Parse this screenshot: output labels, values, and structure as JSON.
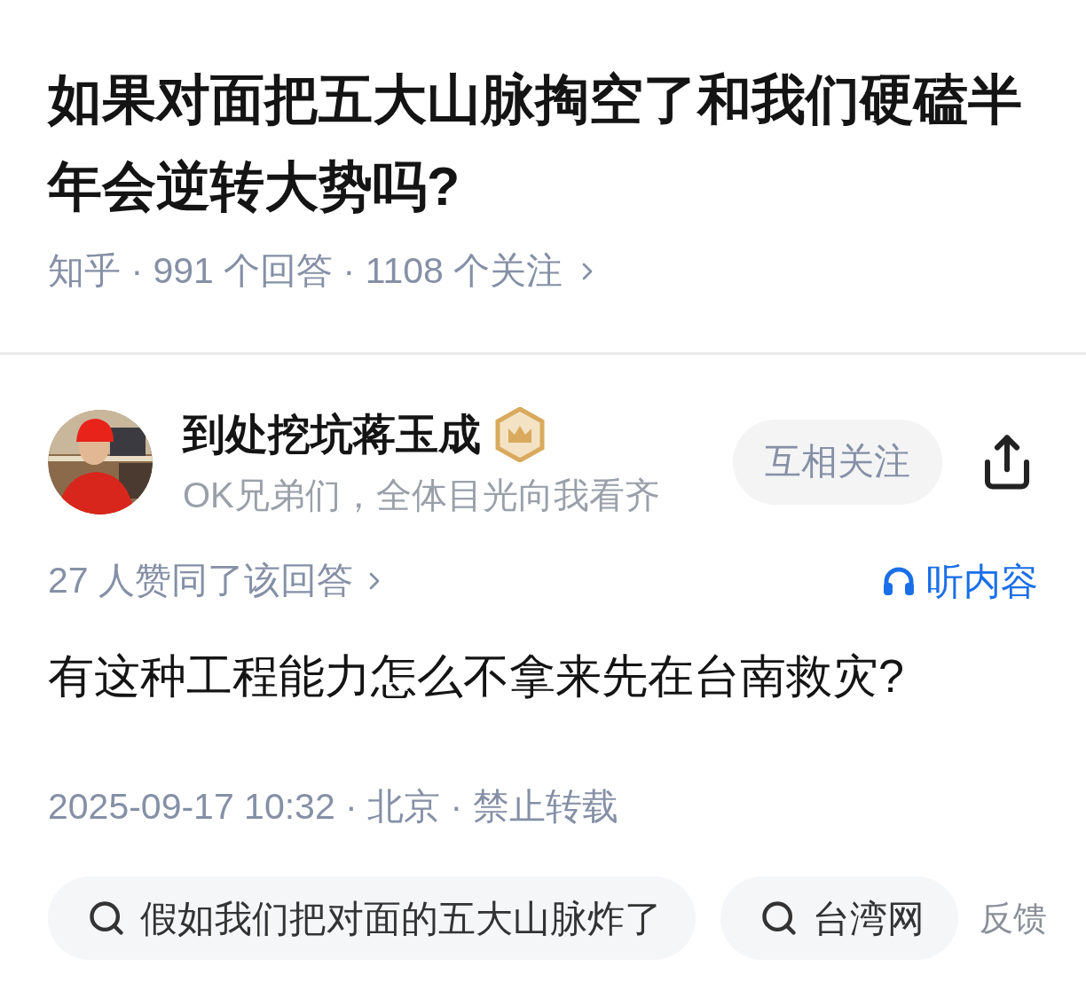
{
  "question": {
    "title": "如果对面把五大山脉掏空了和我们硬磕半年会逆转大势吗?",
    "meta": "知乎 · 991 个回答 · 1108 个关注"
  },
  "author": {
    "name": "到处挖坑蒋玉成",
    "bio": "OK兄弟们，全体目光向我看齐",
    "follow_button": "互相关注"
  },
  "answer": {
    "votes": "27 人赞同了该回答",
    "listen_button": "听内容",
    "text": "有这种工程能力怎么不拿来先在台南救灾?",
    "footer": "2025-09-17 10:32 · 北京 · 禁止转载"
  },
  "related_searches": [
    {
      "text": "假如我们把对面的五大山脉炸了"
    },
    {
      "text": "台湾网"
    }
  ],
  "feedback": "反馈"
}
